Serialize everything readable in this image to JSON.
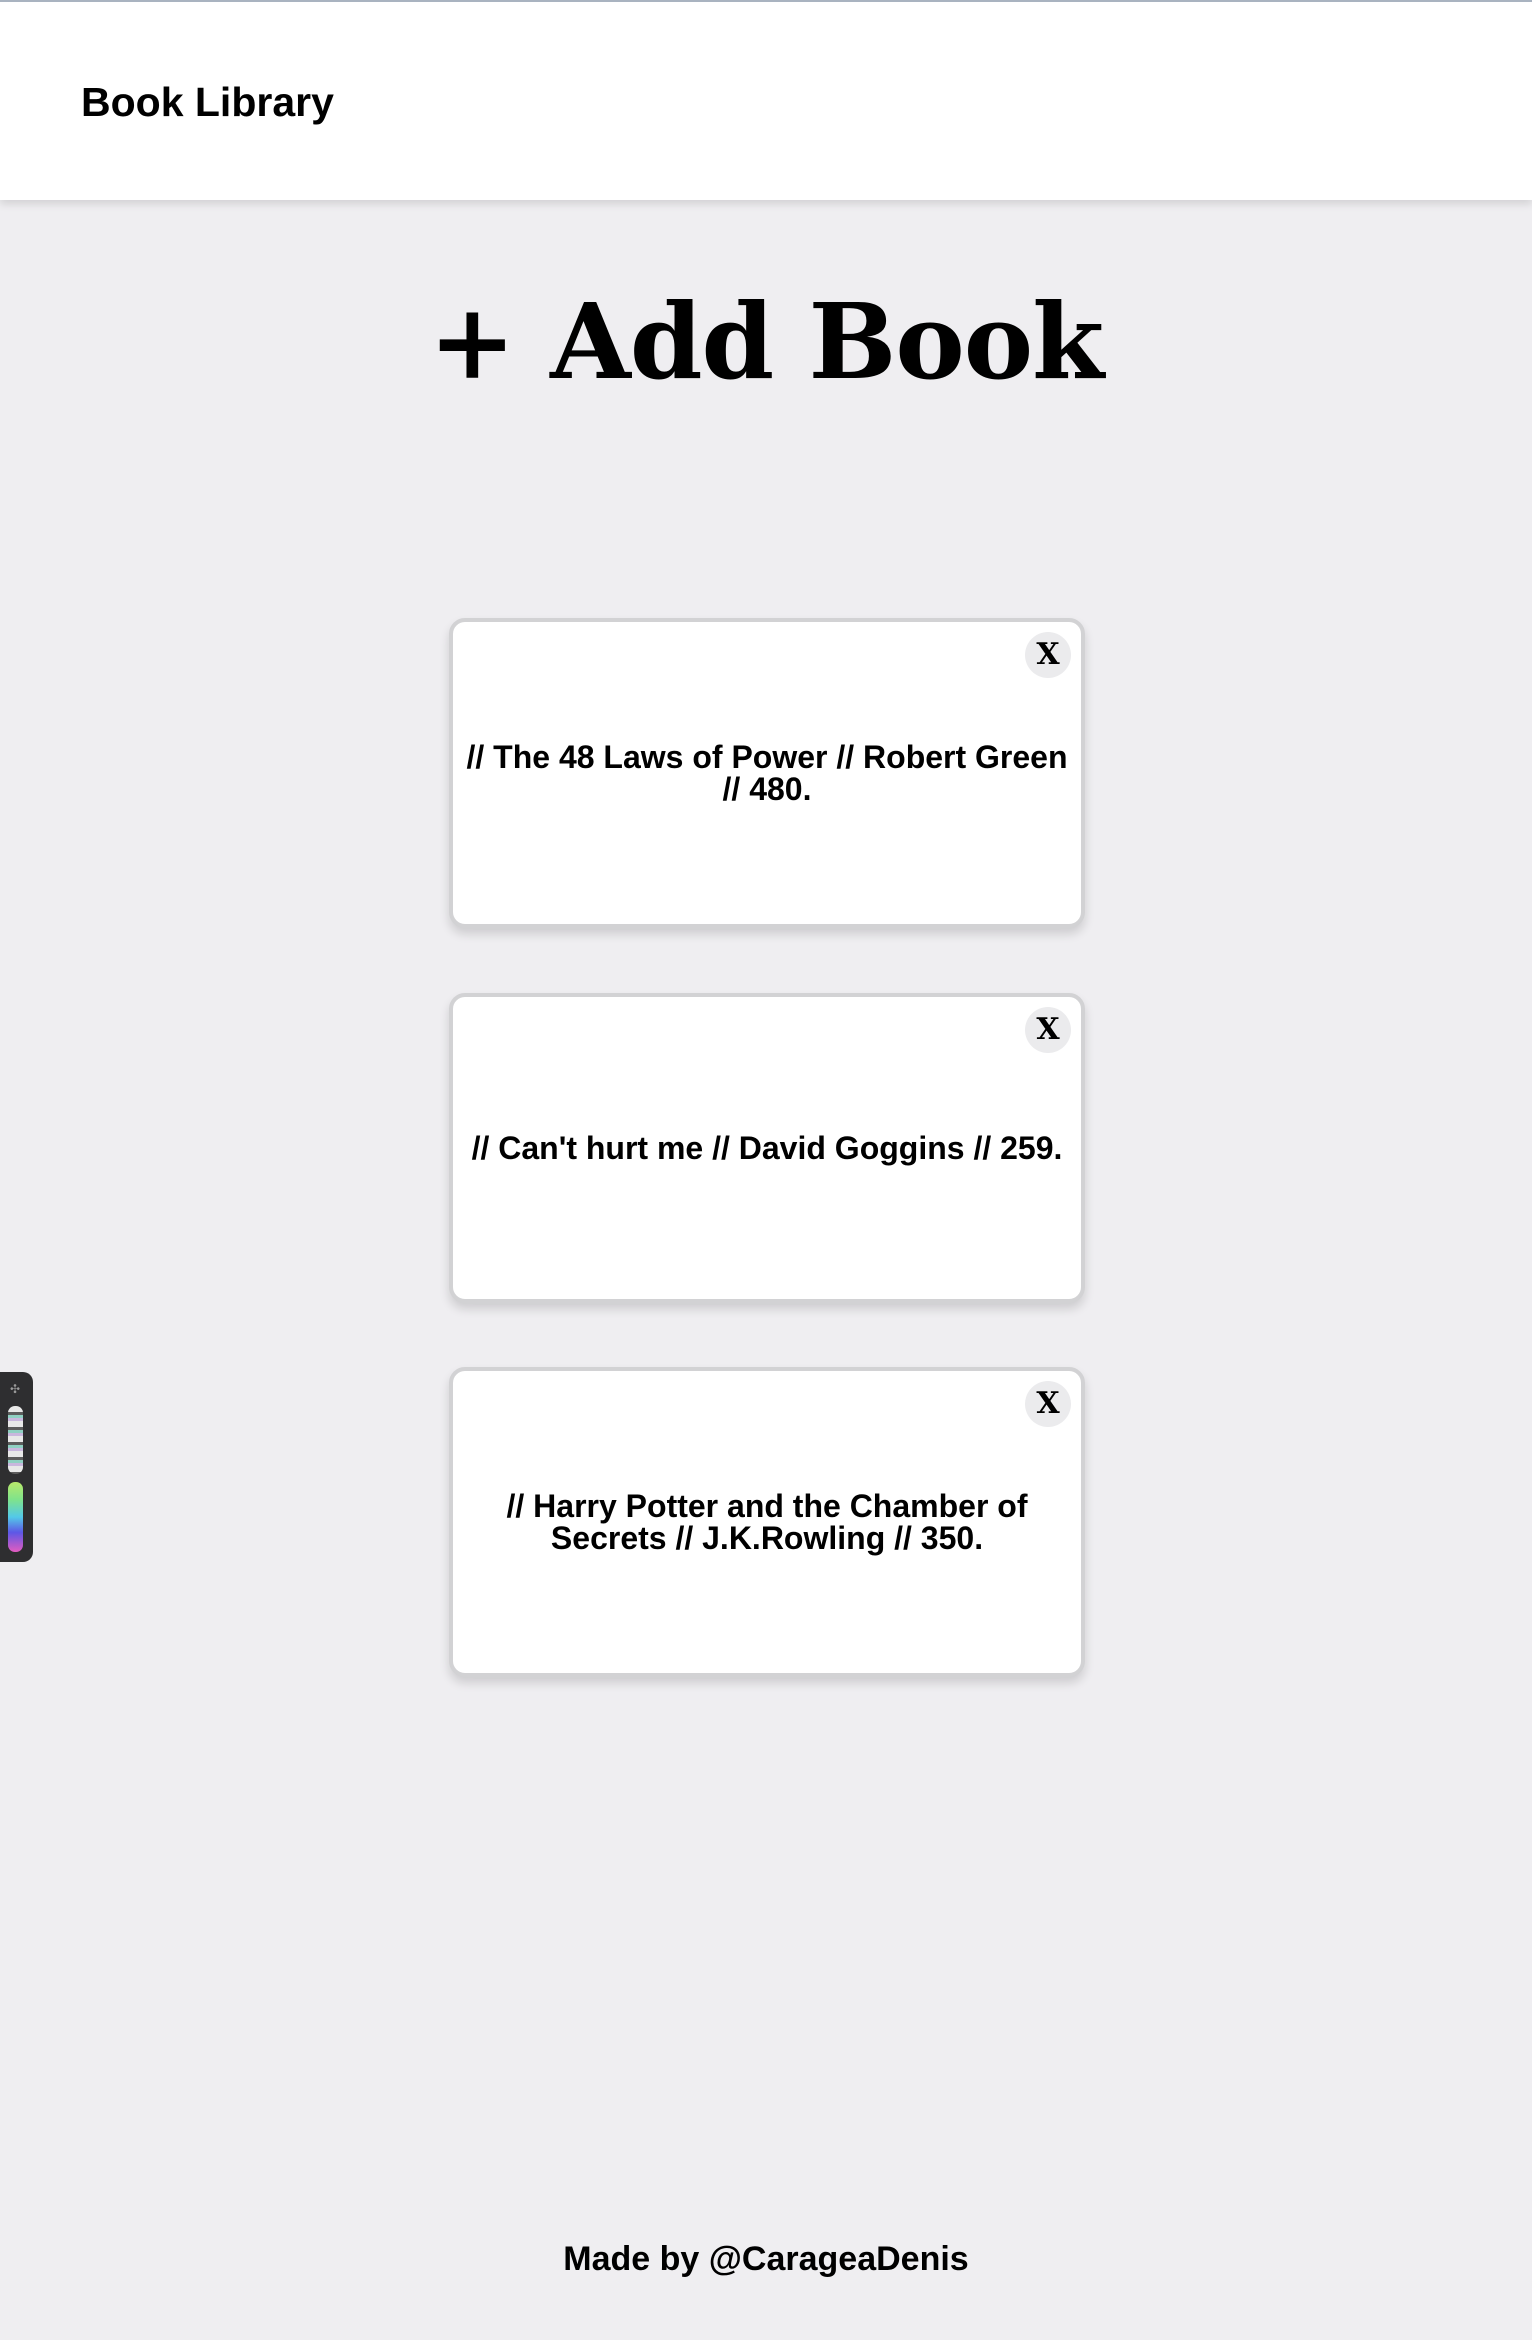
{
  "header": {
    "title": "Book Library"
  },
  "main": {
    "add_book_label": "+ Add Book",
    "books": [
      {
        "text": "// The 48 Laws of Power // Robert Green // 480.",
        "close_label": "X"
      },
      {
        "text": "// Can't hurt me // David Goggins // 259.",
        "close_label": "X"
      },
      {
        "text": "// Harry Potter and the Chamber of Secrets // J.K.Rowling // 350.",
        "close_label": "X"
      }
    ]
  },
  "footer": {
    "credit": "Made by @CarageaDenis"
  },
  "colors": {
    "background": "#efeef1",
    "header_background": "#ffffff",
    "card_background": "#ffffff",
    "card_border": "#d2d2d4",
    "close_button_background": "#ebebed",
    "text": "#000000"
  },
  "icons": {
    "palette_widget": "color-palette-icon",
    "close": "close-icon"
  }
}
